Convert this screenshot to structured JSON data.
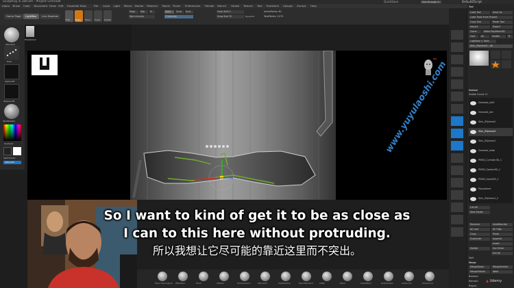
{
  "titlebar": {
    "title": "Sculpting in ZBrush - Project Grenade",
    "quicksave": "QuickSave",
    "brush_field": "See-through  0",
    "ui_label": "DefaultZScript"
  },
  "menubar": {
    "items": [
      "Alpha",
      "Brush",
      "Color",
      "Document",
      "Draw",
      "Edit",
      "Essential Tools",
      "File",
      "Layer",
      "Light",
      "Macro",
      "Marker",
      "Material",
      "Movie",
      "Picker",
      "Preferences",
      "Render",
      "Stencil",
      "Stroke",
      "Texture",
      "Tool",
      "Transform",
      "Zplugin",
      "Zscript",
      "Help"
    ]
  },
  "topshelf": {
    "tabs": [
      "Home Page",
      "LightBox",
      "Live Boolean"
    ],
    "active_tab": "LightBox",
    "draw_tools": [
      "Edit",
      "Draw",
      "Move",
      "Scale",
      "Rotate"
    ],
    "mrgb": [
      "Mrgb",
      "Rgb",
      "M"
    ],
    "zadd": [
      "Zadd",
      "Zsub",
      "Zcut"
    ],
    "focal_shift": "Focal Shift 0",
    "draw_size": "Draw Size 33",
    "dynamic": "Dynamic",
    "active_points": "ActivePoints: 80",
    "total_points": "TotalPoints: 2,074",
    "rgb_intensity": "Rgb Intensity",
    "z_intensity": "Z Intensity"
  },
  "leftpanel": {
    "brush_label": "Standard",
    "stroke_label": "Dots",
    "alpha_label": "Alpha Off",
    "texture_label": "Texture Off",
    "material_label": "SkinShade4",
    "gradient_label": "Gradient",
    "switch_color": "SwitchColor",
    "alternate": "Alternate",
    "thumb_label": "PolySphere"
  },
  "rightpanel": {
    "header": "Tool",
    "buttons": [
      "Load Tool",
      "Save As",
      "Load Tools From Project",
      "Copy Tool",
      "Paste Tool",
      "Import",
      "Export",
      "Clone",
      "Make PolyMesh3D",
      "GoZ",
      "All",
      "Visible",
      "R",
      "Lightbox > Tools"
    ],
    "current_tool": "Skin_ZSphere3 : 48",
    "subtool_header": "Subtool",
    "visible_count": "Visible Count 11",
    "subtools": [
      "Grenade_old2",
      "Grenade_old",
      "Skin_ZSphere2",
      "Skin_ZSphere3",
      "Skin_ZSphere1",
      "Grenade_slide",
      "PM3D_Cylinder3D_1",
      "PM3D_Sphere3D_1",
      "PM3D_Spiral3D_1",
      "Polysphere",
      "Skin_ZSphere1_2"
    ],
    "list_all": "List All",
    "new_folder": "New Folder",
    "rename": "Rename",
    "auto_reorder": "AutoReorder",
    "all_low": "All Low",
    "all_high": "All High",
    "copy": "Copy",
    "paste": "Paste",
    "duplicate": "Duplicate",
    "append": "Append",
    "insert": "Insert",
    "del_other": "Del Other",
    "delete": "Delete",
    "del_all": "Del All",
    "split": "Split",
    "merge": "Merge",
    "merge_down": "MergeDown",
    "merge_similar": "MergeSimilar",
    "merge_visible": "MergeVisible",
    "weld": "Weld",
    "boolean": "Boolean",
    "remesh": "Remesh",
    "project": "Project"
  },
  "bottomshelf": {
    "brushes": [
      "Move Topological",
      "ZModeler",
      "Pinch",
      "hPolish",
      "TrimDynamic",
      "Standard",
      "ClayBuildup",
      "DamStandard",
      "Inflat",
      "Move",
      "SelectRect",
      "SelectLasso",
      "ClipCurve",
      "SliceCurve"
    ]
  },
  "subtitles": {
    "en_line1": "So I want to kind of get it to be as close as",
    "en_line2": "I can to this here without protruding.",
    "zh_line": "所以我想让它尽可能的靠近这里而不突出。"
  },
  "watermark": "www.yuyulaoshi.com",
  "udemy": "Udemy",
  "colors": {
    "accent_orange": "#e88a1a",
    "selection_blue": "#1d78c8",
    "mesh_gray": "#9a9a9a",
    "subtitle_white": "#ffffff",
    "watermark_blue": "#3c96e6"
  }
}
